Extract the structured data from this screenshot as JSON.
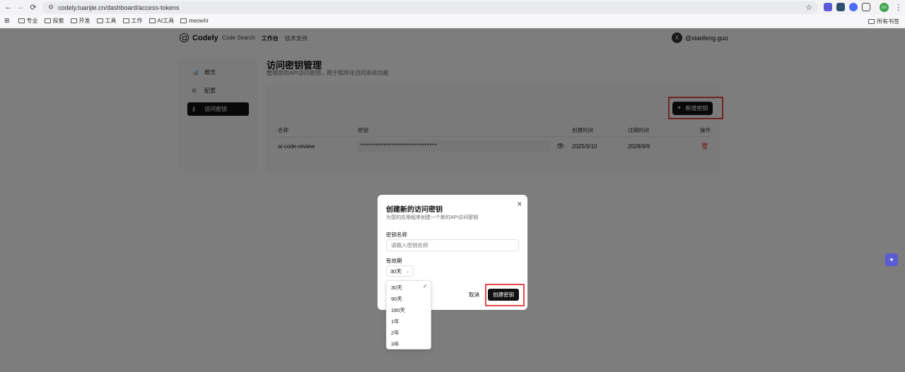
{
  "browser": {
    "url": "codely.tuanjie.cn/dashboard/access-tokens",
    "bookmarks": [
      "专业",
      "探索",
      "开发",
      "工具",
      "工作",
      "AI工具",
      "meowhi"
    ],
    "all_bookmarks": "所有书签",
    "profile_initials": "GX"
  },
  "app": {
    "logo": "Codely",
    "nav": [
      "Code Search",
      "工作台",
      "技术支持"
    ],
    "user": {
      "avatar_initial": "X",
      "name": "@xiaofeng.guo"
    }
  },
  "sidebar": {
    "items": [
      {
        "label": "概览",
        "icon": "chart-icon"
      },
      {
        "label": "配置",
        "icon": "gear-icon"
      },
      {
        "label": "访问密钥",
        "icon": "key-icon"
      }
    ]
  },
  "main": {
    "title": "访问密钥管理",
    "subtitle": "管理您的API访问密钥，用于程序化访问系统功能",
    "add_button": "新增密钥",
    "table": {
      "headers": [
        "名称",
        "密钥",
        "创建时间",
        "过期时间",
        "操作"
      ],
      "rows": [
        {
          "name": "ai-code-review",
          "token": "******************************",
          "created": "2025/9/10",
          "expires": "2028/9/9"
        }
      ]
    }
  },
  "modal": {
    "title": "创建新的访问密钥",
    "description": "为您的应用程序创建一个新的API访问密钥",
    "name_label": "密钥名称",
    "name_placeholder": "请输入密钥名称",
    "expiry_label": "有效期",
    "expiry_value": "30天",
    "expiry_options": [
      "30天",
      "90天",
      "180天",
      "1年",
      "2年",
      "3年"
    ],
    "cancel": "取消",
    "create": "创建密钥"
  },
  "colors": {
    "accent": "#111111",
    "highlight": "#e5484d",
    "float_icon": "#5b5bd6"
  }
}
